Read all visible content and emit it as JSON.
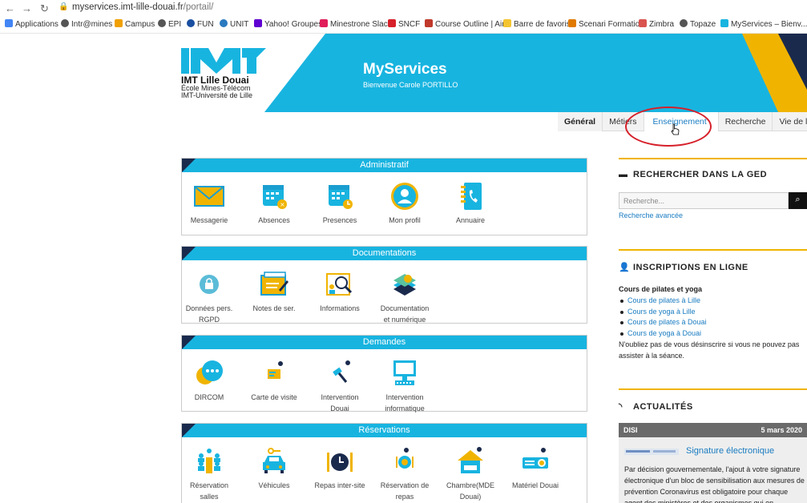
{
  "browser": {
    "back": "←",
    "forward": "→",
    "reload": "↻",
    "url_host": "myservices.imt-lille-douai.fr",
    "url_path": "/portail/",
    "bookmarks": [
      "Applications",
      "Intr@mines",
      "Campus",
      "EPI",
      "FUN",
      "UNIT",
      "Yahoo! Groupes",
      "Minestrone Slack",
      "SNCF",
      "Course Outline | Air...",
      "Barre de favoris",
      "Scenari Formation",
      "Zimbra",
      "Topaze",
      "MyServices – Bienv..."
    ]
  },
  "header": {
    "logo_title": "IMT Lille Douai",
    "logo_line1": "École Mines-Télécom",
    "logo_line2": "IMT-Université de Lille",
    "app_title": "MyServices",
    "welcome": "Bienvenue Carole PORTILLO"
  },
  "tabs": [
    "Général",
    "Métiers",
    "Enseignement",
    "Recherche",
    "Vie de l'école"
  ],
  "sections": {
    "administratif": {
      "title": "Administratif",
      "tiles": [
        [
          "Messagerie",
          ""
        ],
        [
          "Absences",
          ""
        ],
        [
          "Presences",
          ""
        ],
        [
          "Mon profil",
          ""
        ],
        [
          "Annuaire",
          ""
        ]
      ]
    },
    "documentations": {
      "title": "Documentations",
      "tiles": [
        [
          "Données pers.",
          "RGPD"
        ],
        [
          "Notes de ser.",
          ""
        ],
        [
          "Informations",
          ""
        ],
        [
          "Documentation",
          "et numérique"
        ]
      ]
    },
    "demandes": {
      "title": "Demandes",
      "tiles": [
        [
          "DIRCOM",
          ""
        ],
        [
          "Carte de visite",
          ""
        ],
        [
          "Intervention",
          "Douai"
        ],
        [
          "Intervention",
          "informatique"
        ]
      ]
    },
    "reservations": {
      "title": "Réservations",
      "tiles": [
        [
          "Réservation",
          "salles"
        ],
        [
          "Véhicules",
          ""
        ],
        [
          "Repas inter-site",
          ""
        ],
        [
          "Réservation de",
          "repas"
        ],
        [
          "Chambre(MDE",
          "Douai)"
        ],
        [
          "Matériel Douai",
          ""
        ]
      ]
    }
  },
  "sidebar": {
    "ged_title": "RECHERCHER DANS LA GED",
    "search_placeholder": "Recherche...",
    "advanced": "Recherche avancée",
    "inscriptions_title": "INSCRIPTIONS EN LIGNE",
    "course_heading": "Cours de pilates et yoga",
    "courses": [
      "Cours de pilates à Lille",
      "Cours de yoga à Lille",
      "Cours de pilates à Douai",
      "Cours de yoga à Douai"
    ],
    "note": "N'oubliez pas de vous désinscrire si vous ne pouvez pas assister à la séance.",
    "news_title": "ACTUALITÉS",
    "news_tag": "DISI",
    "news_date": "5 mars 2020",
    "news_headline": "Signature électronique",
    "news_text": "Par décision gouvernementale, l'ajout à votre signature électronique d'un bloc de sensibilisation aux mesures de prévention Coronavirus est obligatoire pour chaque agent des ministères et des organismes qui en dépendent."
  },
  "colors": {
    "brand_cyan": "#18b4e0",
    "brand_navy": "#1a2a4d",
    "brand_yellow": "#f0b400",
    "link_blue": "#1a7cc1",
    "annotation_red": "#d6202a"
  }
}
